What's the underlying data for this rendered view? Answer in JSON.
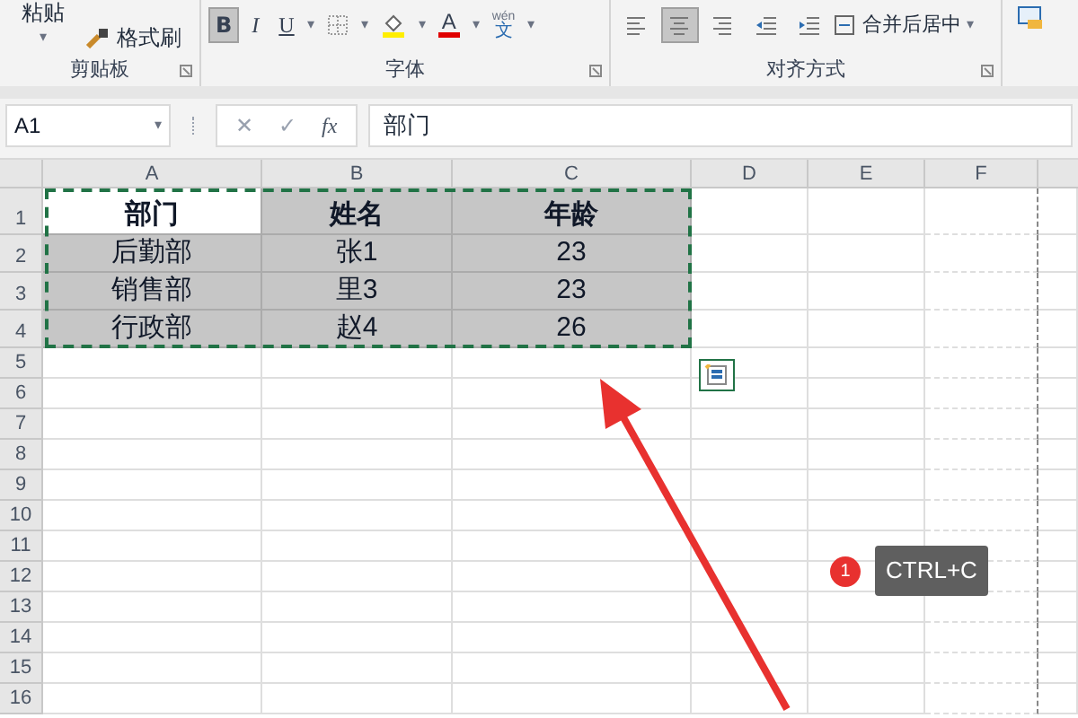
{
  "ribbon": {
    "groups": [
      {
        "label": "剪贴板",
        "paste": {
          "label": "粘贴",
          "caret": "▾"
        },
        "format_painter": {
          "label": "格式刷"
        }
      },
      {
        "label": "字体",
        "buttons": [
          {
            "kind": "bold",
            "label": "B",
            "selected": true
          },
          {
            "kind": "italic",
            "label": "I",
            "selected": false
          },
          {
            "kind": "underline",
            "label": "U",
            "selected": false,
            "caret": "▾"
          },
          {
            "kind": "border",
            "selected": false,
            "caret": "▾"
          },
          {
            "kind": "fill",
            "selected": false,
            "caret": "▾"
          },
          {
            "kind": "fontcolor",
            "label": "A",
            "selected": false,
            "caret": "▾"
          },
          {
            "kind": "pinyin",
            "label": "wén",
            "sub": "文",
            "selected": false,
            "caret": "▾"
          }
        ]
      },
      {
        "label": "对齐方式",
        "buttons": [
          {
            "kind": "align-left",
            "selected": false
          },
          {
            "kind": "align-center",
            "selected": true
          },
          {
            "kind": "align-right",
            "selected": false
          },
          {
            "kind": "outdent",
            "selected": false
          },
          {
            "kind": "indent",
            "selected": false
          }
        ],
        "merge": {
          "label": "合并后居中",
          "caret": "▾"
        }
      }
    ]
  },
  "formula_bar": {
    "name_box": "A1",
    "caret": "▾",
    "cancel": "✕",
    "enter": "✓",
    "fx": "fx",
    "value": "部门"
  },
  "sheet": {
    "columns": [
      "A",
      "B",
      "C",
      "D",
      "E",
      "F"
    ],
    "rows": [
      {
        "label": "1",
        "cells": [
          {
            "text": "部门",
            "active": true,
            "selected": true
          },
          {
            "text": "姓名",
            "active": false,
            "selected": true
          },
          {
            "text": "年龄",
            "active": false,
            "selected": true
          }
        ]
      },
      {
        "label": "2",
        "cells": [
          {
            "text": "后勤部",
            "active": false,
            "selected": true
          },
          {
            "text": "张1",
            "active": false,
            "selected": true
          },
          {
            "text": "23",
            "active": false,
            "selected": true
          }
        ]
      },
      {
        "label": "3",
        "cells": [
          {
            "text": "销售部",
            "active": false,
            "selected": true
          },
          {
            "text": "里3",
            "active": false,
            "selected": true
          },
          {
            "text": "23",
            "active": false,
            "selected": true
          }
        ]
      },
      {
        "label": "4",
        "cells": [
          {
            "text": "行政部",
            "active": false,
            "selected": true
          },
          {
            "text": "赵4",
            "active": false,
            "selected": true
          },
          {
            "text": "26",
            "active": false,
            "selected": true
          }
        ]
      },
      {
        "label": "5"
      },
      {
        "label": "6"
      },
      {
        "label": "7"
      },
      {
        "label": "8"
      },
      {
        "label": "9"
      },
      {
        "label": "10"
      },
      {
        "label": "11"
      },
      {
        "label": "12"
      },
      {
        "label": "13"
      },
      {
        "label": "14"
      },
      {
        "label": "15"
      },
      {
        "label": "16"
      }
    ]
  },
  "annotation": {
    "step": "1",
    "shortcut": "CTRL+C"
  }
}
